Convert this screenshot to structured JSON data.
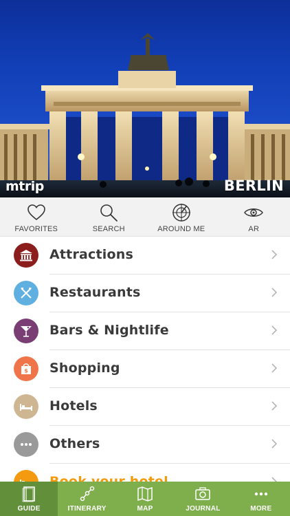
{
  "hero": {
    "brand": "mtrip",
    "city": "BERLIN"
  },
  "toolbar": {
    "items": [
      {
        "label": "FAVORITES",
        "icon": "heart-icon"
      },
      {
        "label": "SEARCH",
        "icon": "search-icon"
      },
      {
        "label": "AROUND ME",
        "icon": "radar-icon"
      },
      {
        "label": "AR",
        "icon": "eye-icon"
      }
    ]
  },
  "categories": [
    {
      "label": "Attractions",
      "icon": "temple-icon",
      "color": "#8c1d1d"
    },
    {
      "label": "Restaurants",
      "icon": "fork-knife-icon",
      "color": "#5fb0e0"
    },
    {
      "label": "Bars & Nightlife",
      "icon": "cocktail-icon",
      "color": "#7a3d74"
    },
    {
      "label": "Shopping",
      "icon": "shopping-bag-icon",
      "color": "#f0744a"
    },
    {
      "label": "Hotels",
      "icon": "bed-icon",
      "color": "#cfb693"
    },
    {
      "label": "Others",
      "icon": "dots-icon",
      "color": "#9a9a9a"
    },
    {
      "label": "Book your hotel",
      "icon": "bed-icon",
      "color": "#f39a10"
    }
  ],
  "tabbar": {
    "tabs": [
      {
        "label": "GUIDE",
        "icon": "book-icon",
        "active": true
      },
      {
        "label": "ITINERARY",
        "icon": "route-icon",
        "active": false
      },
      {
        "label": "MAP",
        "icon": "map-icon",
        "active": false
      },
      {
        "label": "JOURNAL",
        "icon": "camera-icon",
        "active": false
      },
      {
        "label": "MORE",
        "icon": "more-dots-icon",
        "active": false
      }
    ]
  },
  "colors": {
    "tab_bar": "#7fae4c",
    "tab_active": "#62903a",
    "accent_orange": "#f39a10",
    "sky": "#1240b8"
  }
}
